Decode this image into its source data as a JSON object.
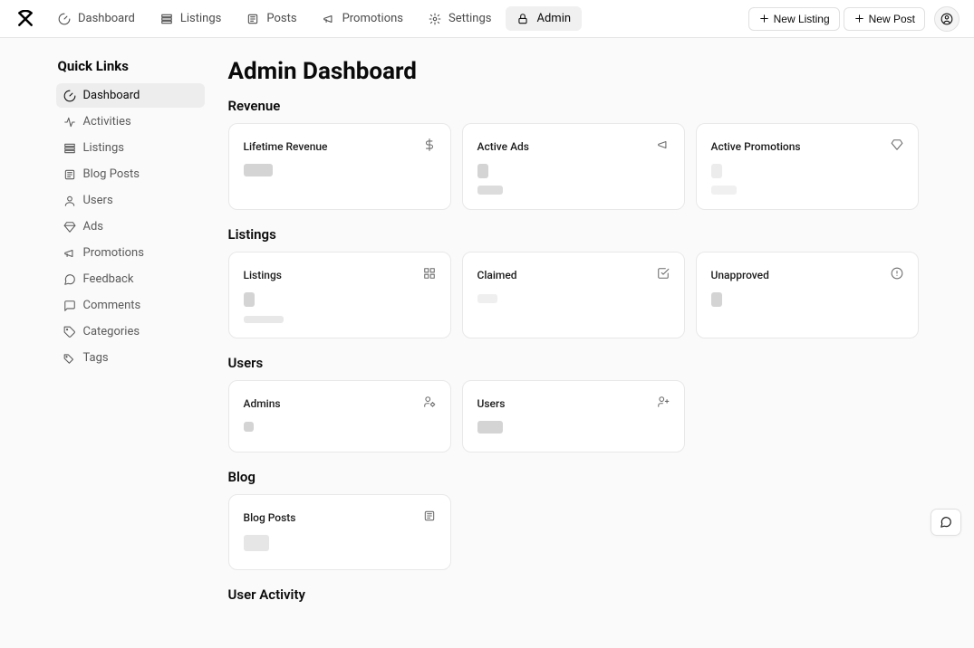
{
  "topnav": {
    "items": [
      {
        "label": "Dashboard"
      },
      {
        "label": "Listings"
      },
      {
        "label": "Posts"
      },
      {
        "label": "Promotions"
      },
      {
        "label": "Settings"
      },
      {
        "label": "Admin"
      }
    ],
    "new_listing_label": "New Listing",
    "new_post_label": "New Post"
  },
  "sidebar": {
    "title": "Quick Links",
    "items": [
      {
        "label": "Dashboard"
      },
      {
        "label": "Activities"
      },
      {
        "label": "Listings"
      },
      {
        "label": "Blog Posts"
      },
      {
        "label": "Users"
      },
      {
        "label": "Ads"
      },
      {
        "label": "Promotions"
      },
      {
        "label": "Feedback"
      },
      {
        "label": "Comments"
      },
      {
        "label": "Categories"
      },
      {
        "label": "Tags"
      }
    ]
  },
  "page": {
    "title": "Admin Dashboard"
  },
  "sections": {
    "revenue": {
      "title": "Revenue",
      "cards": [
        {
          "title": "Lifetime Revenue"
        },
        {
          "title": "Active Ads"
        },
        {
          "title": "Active Promotions"
        }
      ]
    },
    "listings": {
      "title": "Listings",
      "cards": [
        {
          "title": "Listings"
        },
        {
          "title": "Claimed"
        },
        {
          "title": "Unapproved"
        }
      ]
    },
    "users": {
      "title": "Users",
      "cards": [
        {
          "title": "Admins"
        },
        {
          "title": "Users"
        }
      ]
    },
    "blog": {
      "title": "Blog",
      "cards": [
        {
          "title": "Blog Posts"
        }
      ]
    },
    "user_activity": {
      "title": "User Activity"
    }
  }
}
